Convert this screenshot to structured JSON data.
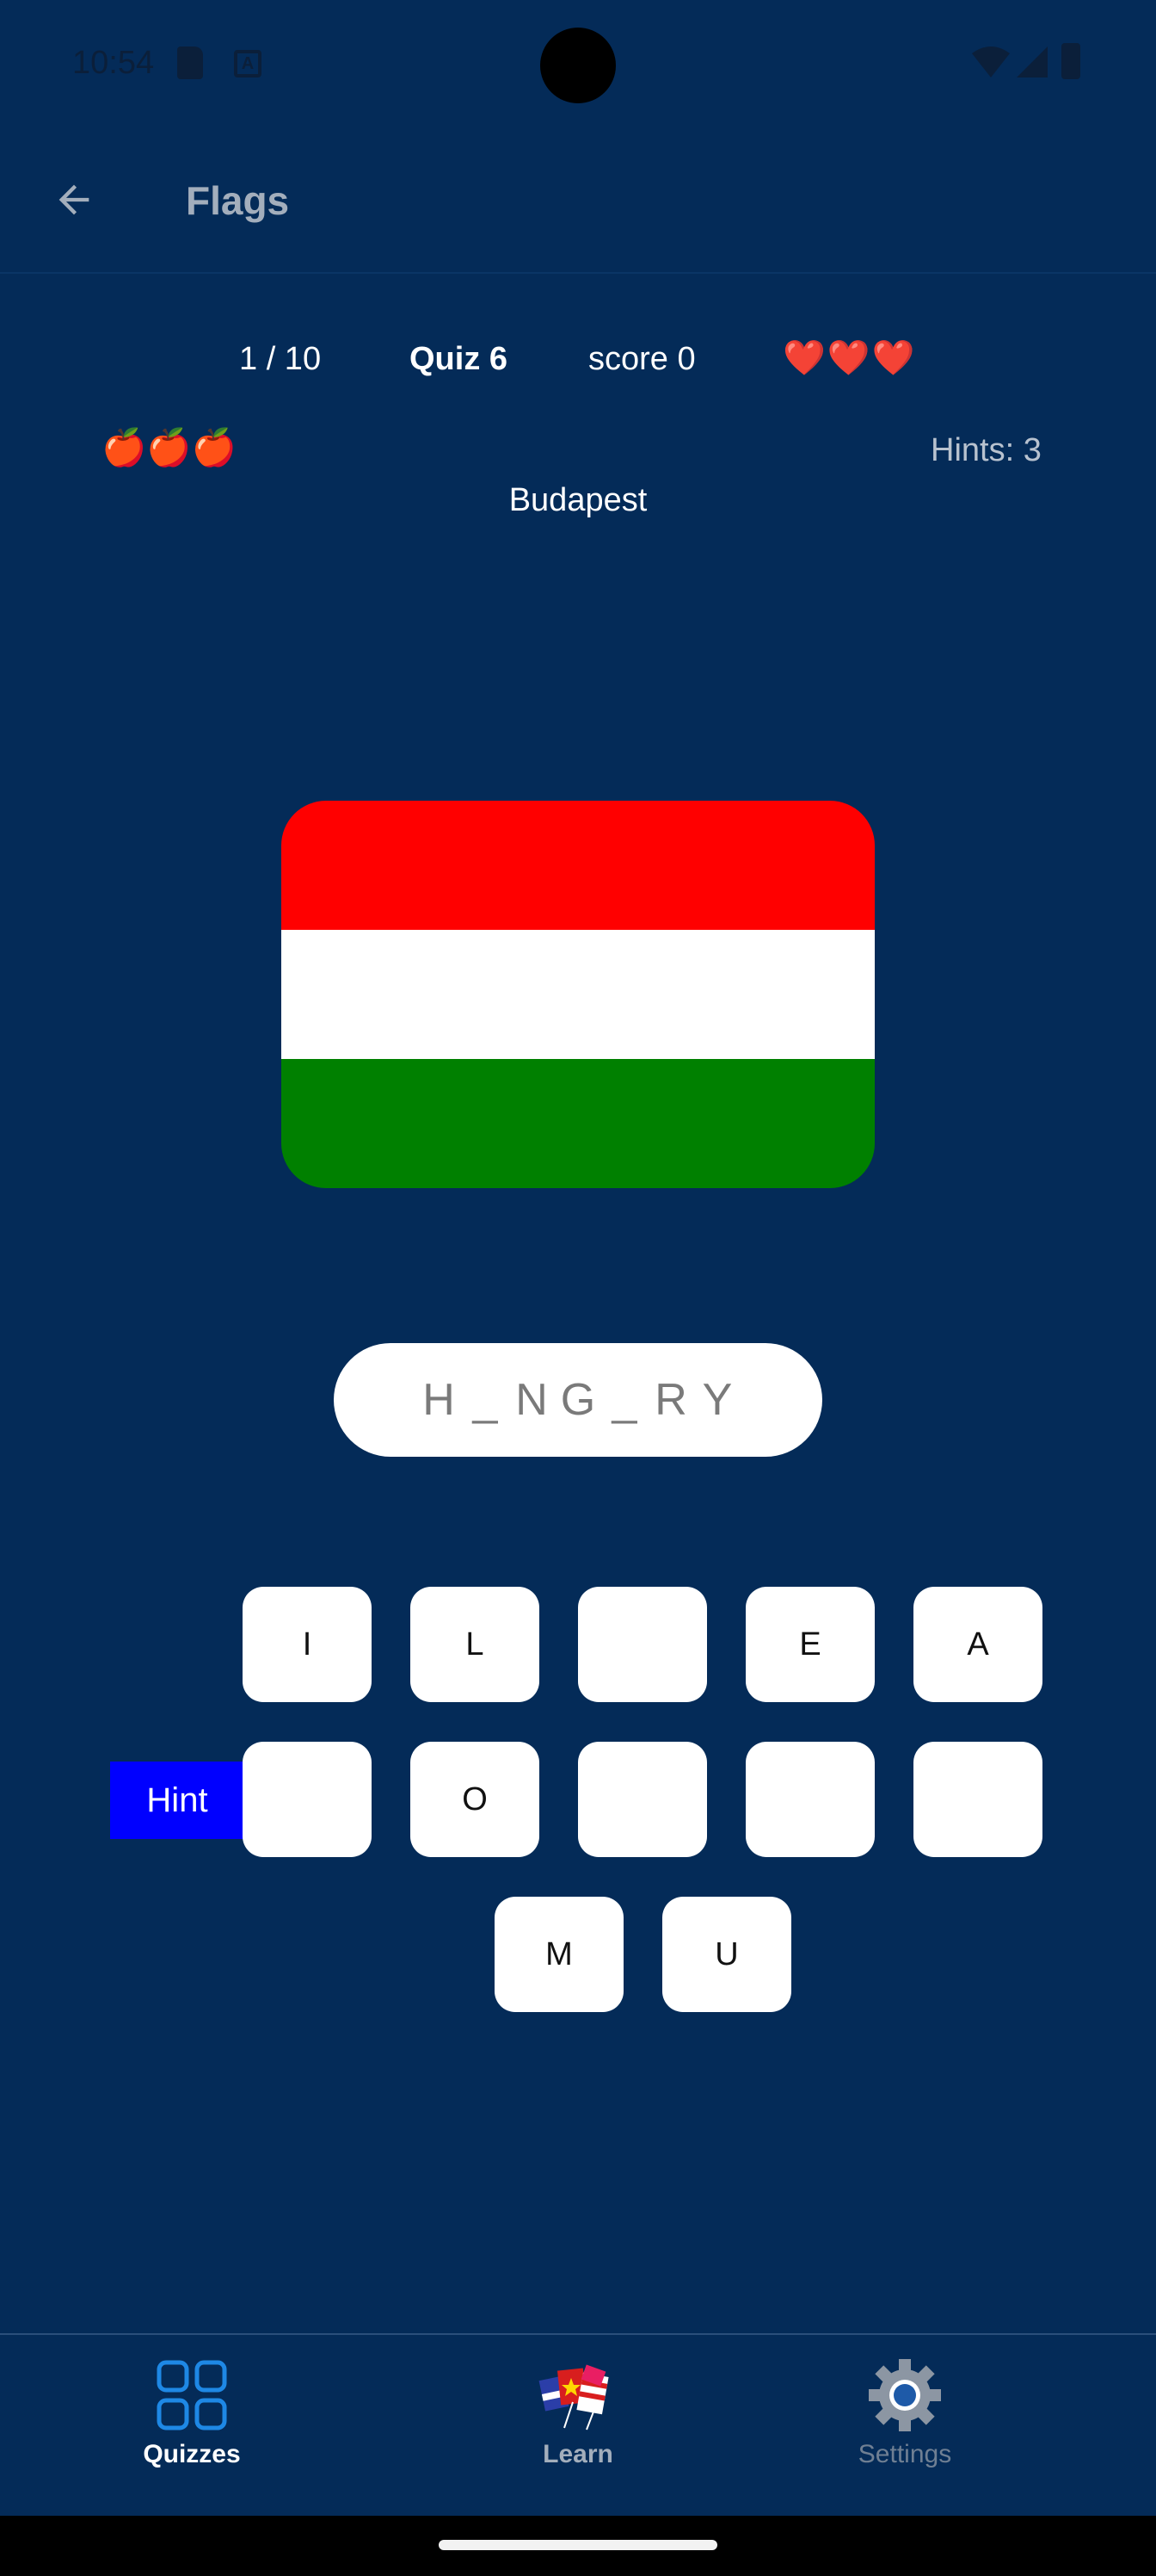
{
  "status_bar": {
    "time": "10:54",
    "icons": [
      "sd-card-icon",
      "a-icon",
      "wifi-icon",
      "signal-icon",
      "battery-icon"
    ]
  },
  "app_bar": {
    "title": "Flags",
    "back_icon": "arrow-back-icon"
  },
  "quiz": {
    "progress": "1 / 10",
    "quiz_label": "Quiz 6",
    "score": "score 0",
    "lives": "❤️❤️❤️",
    "apples": "🍎🍎🍎",
    "hints": "Hints: 3",
    "capital": "Budapest",
    "flag": {
      "stripes": [
        "#ff0000",
        "#ffffff",
        "#008000"
      ]
    },
    "answer_chars": [
      "H",
      "_",
      "N",
      "G",
      "_",
      "R",
      "Y"
    ],
    "hint_button": "Hint",
    "tiles_row1": [
      "I",
      "L",
      "",
      "E",
      "A"
    ],
    "tiles_row2": [
      "",
      "O",
      "",
      "",
      ""
    ],
    "tiles_row3": [
      "M",
      "U"
    ]
  },
  "bottom_nav": {
    "items": [
      {
        "label": "Quizzes",
        "icon": "grid-icon",
        "active": true
      },
      {
        "label": "Learn",
        "icon": "flags-icon",
        "active": false
      },
      {
        "label": "Settings",
        "icon": "gear-icon",
        "active": false
      }
    ]
  },
  "colors": {
    "background": "#042b58",
    "hint_button": "#0000ff",
    "active_nav": "#1e88e5"
  }
}
